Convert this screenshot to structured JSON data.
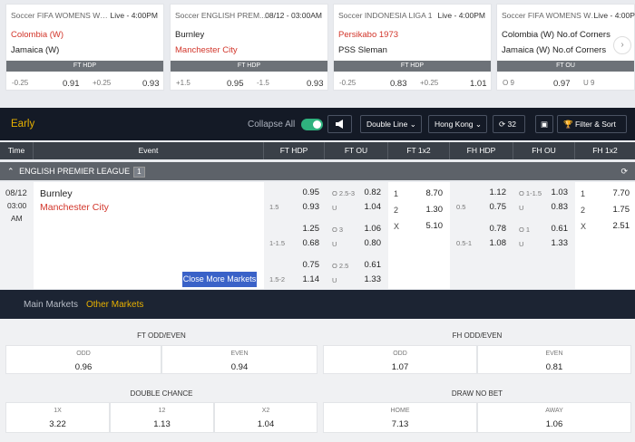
{
  "cards": [
    {
      "competition": "Soccer FIFA WOMENS WO...",
      "status": "Live - 4:00PM",
      "team1": "Colombia (W)",
      "team2": "Jamaica (W)",
      "market": "FT HDP",
      "o1": {
        "label": "-0.25",
        "value": "0.91"
      },
      "o2": {
        "label": "+0.25",
        "value": "0.93"
      }
    },
    {
      "competition": "Soccer ENGLISH PREM...",
      "status": "08/12 - 03:00AM",
      "team1": "Burnley",
      "team2": "Manchester City",
      "market": "FT HDP",
      "o1": {
        "label": "+1.5",
        "value": "0.95"
      },
      "o2": {
        "label": "-1.5",
        "value": "0.93"
      }
    },
    {
      "competition": "Soccer INDONESIA LIGA 1",
      "status": "Live - 4:00PM",
      "team1": "Persikabo 1973",
      "team2": "PSS Sleman",
      "market": "FT HDP",
      "o1": {
        "label": "-0.25",
        "value": "0.83"
      },
      "o2": {
        "label": "+0.25",
        "value": "1.01"
      }
    },
    {
      "competition": "Soccer FIFA WOMENS WO...",
      "status": "Live - 4:00PM",
      "team1": "Colombia (W) No.of Corners",
      "team2": "Jamaica (W) No.of Corners",
      "market": "FT OU",
      "o1": {
        "label": "O 9",
        "value": "0.97"
      },
      "o2": {
        "label": "U 9",
        "value": ""
      }
    }
  ],
  "toolbar": {
    "title": "Early",
    "collapse": "Collapse All",
    "line": "Double Line",
    "odds": "Hong Kong",
    "count": "32",
    "filter": "Filter & Sort"
  },
  "columns": {
    "time": "Time",
    "event": "Event",
    "ft_hdp": "FT HDP",
    "ft_ou": "FT OU",
    "ft_1x2": "FT 1x2",
    "fh_hdp": "FH HDP",
    "fh_ou": "FH OU",
    "fh_1x2": "FH 1x2"
  },
  "league": {
    "name": "ENGLISH PREMIER LEAGUE",
    "count": "1"
  },
  "match": {
    "date": "08/12",
    "time": "03:00",
    "ampm": "AM",
    "home": "Burnley",
    "away": "Manchester City",
    "close_more": "Close More Markets"
  },
  "ft_hdp": [
    {
      "h1": "0.95",
      "line": "1.5",
      "h2": "0.93"
    },
    {
      "h1": "1.25",
      "line": "1-1.5",
      "h2": "0.68"
    },
    {
      "h1": "0.75",
      "line": "1.5-2",
      "h2": "1.14"
    }
  ],
  "ft_ou": [
    {
      "o": "O 2.5-3",
      "ov": "0.82",
      "u": "U",
      "uv": "1.04"
    },
    {
      "o": "O 3",
      "ov": "1.06",
      "u": "U",
      "uv": "0.80"
    },
    {
      "o": "O 2.5",
      "ov": "0.61",
      "u": "U",
      "uv": "1.33"
    }
  ],
  "ft_1x2": [
    {
      "k": "1",
      "v": "8.70"
    },
    {
      "k": "2",
      "v": "1.30"
    },
    {
      "k": "X",
      "v": "5.10"
    }
  ],
  "fh_hdp": [
    {
      "h1": "1.12",
      "line": "0.5",
      "h2": "0.75"
    },
    {
      "h1": "0.78",
      "line": "0.5-1",
      "h2": "1.08"
    }
  ],
  "fh_ou": [
    {
      "o": "O 1-1.5",
      "ov": "1.03",
      "u": "U",
      "uv": "0.83"
    },
    {
      "o": "O 1",
      "ov": "0.61",
      "u": "U",
      "uv": "1.33"
    }
  ],
  "fh_1x2": [
    {
      "k": "1",
      "v": "7.70"
    },
    {
      "k": "2",
      "v": "1.75"
    },
    {
      "k": "X",
      "v": "2.51"
    }
  ],
  "tabs": {
    "main": "Main Markets",
    "other": "Other Markets"
  },
  "more": {
    "ft_oe": {
      "title": "FT ODD/EVEN",
      "a": {
        "k": "ODD",
        "v": "0.96"
      },
      "b": {
        "k": "EVEN",
        "v": "0.94"
      }
    },
    "fh_oe": {
      "title": "FH ODD/EVEN",
      "a": {
        "k": "ODD",
        "v": "1.07"
      },
      "b": {
        "k": "EVEN",
        "v": "0.81"
      }
    },
    "dc": {
      "title": "DOUBLE CHANCE",
      "a": {
        "k": "1X",
        "v": "3.22"
      },
      "b": {
        "k": "12",
        "v": "1.13"
      },
      "c": {
        "k": "X2",
        "v": "1.04"
      }
    },
    "dnb": {
      "title": "DRAW NO BET",
      "a": {
        "k": "HOME",
        "v": "7.13"
      },
      "b": {
        "k": "AWAY",
        "v": "1.06"
      }
    }
  },
  "colors": {
    "accent": "#e8b100",
    "live_red": "#d2352a",
    "toggle_green": "#2fb27e",
    "close_btn": "#3a62c8"
  }
}
